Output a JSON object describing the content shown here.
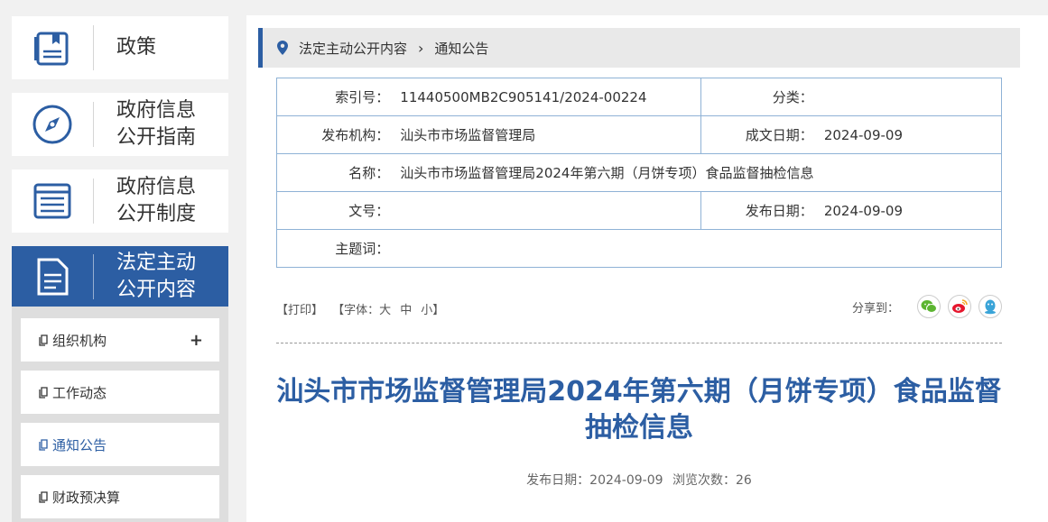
{
  "sidebar": {
    "nav": [
      {
        "label_lines": [
          "政策",
          ""
        ],
        "icon": "policy-book-icon"
      },
      {
        "label_lines": [
          "政府信息",
          "公开指南"
        ],
        "icon": "compass-icon"
      },
      {
        "label_lines": [
          "政府信息",
          "公开制度"
        ],
        "icon": "list-doc-icon"
      },
      {
        "label_lines": [
          "法定主动",
          "公开内容"
        ],
        "icon": "document-icon"
      }
    ],
    "sub_items": [
      {
        "label": "组织机构",
        "expand": "+"
      },
      {
        "label": "工作动态"
      },
      {
        "label": "通知公告"
      },
      {
        "label": "财政预决算"
      }
    ]
  },
  "breadcrumb": {
    "items": [
      "法定主动公开内容",
      "通知公告"
    ]
  },
  "meta": {
    "index_label": "索引号：",
    "index_value": "11440500MB2C905141/2024-00224",
    "category_label": "分类：",
    "category_value": "",
    "publisher_label": "发布机构：",
    "publisher_value": "汕头市市场监督管理局",
    "created_label": "成文日期：",
    "created_value": "2024-09-09",
    "name_label": "名称：",
    "name_value": "汕头市市场监督管理局2024年第六期（月饼专项）食品监督抽检信息",
    "doc_no_label": "文号：",
    "doc_no_value": "",
    "published_label": "发布日期：",
    "published_value": "2024-09-09",
    "subject_label": "主题词：",
    "subject_value": ""
  },
  "toolbar": {
    "print": "【打印】",
    "font_open": "【字体：",
    "font_large": "大",
    "font_medium": "中",
    "font_small": "小】",
    "share_label": "分享到："
  },
  "article": {
    "title": "汕头市市场监督管理局2024年第六期（月饼专项）食品监督抽检信息",
    "pub_date": "发布日期：2024-09-09",
    "views": "浏览次数：26"
  },
  "colors": {
    "accent": "#2c5ea3",
    "wechat": "#5cb531",
    "weibo": "#e6162d",
    "qq": "#3aa4d8"
  }
}
